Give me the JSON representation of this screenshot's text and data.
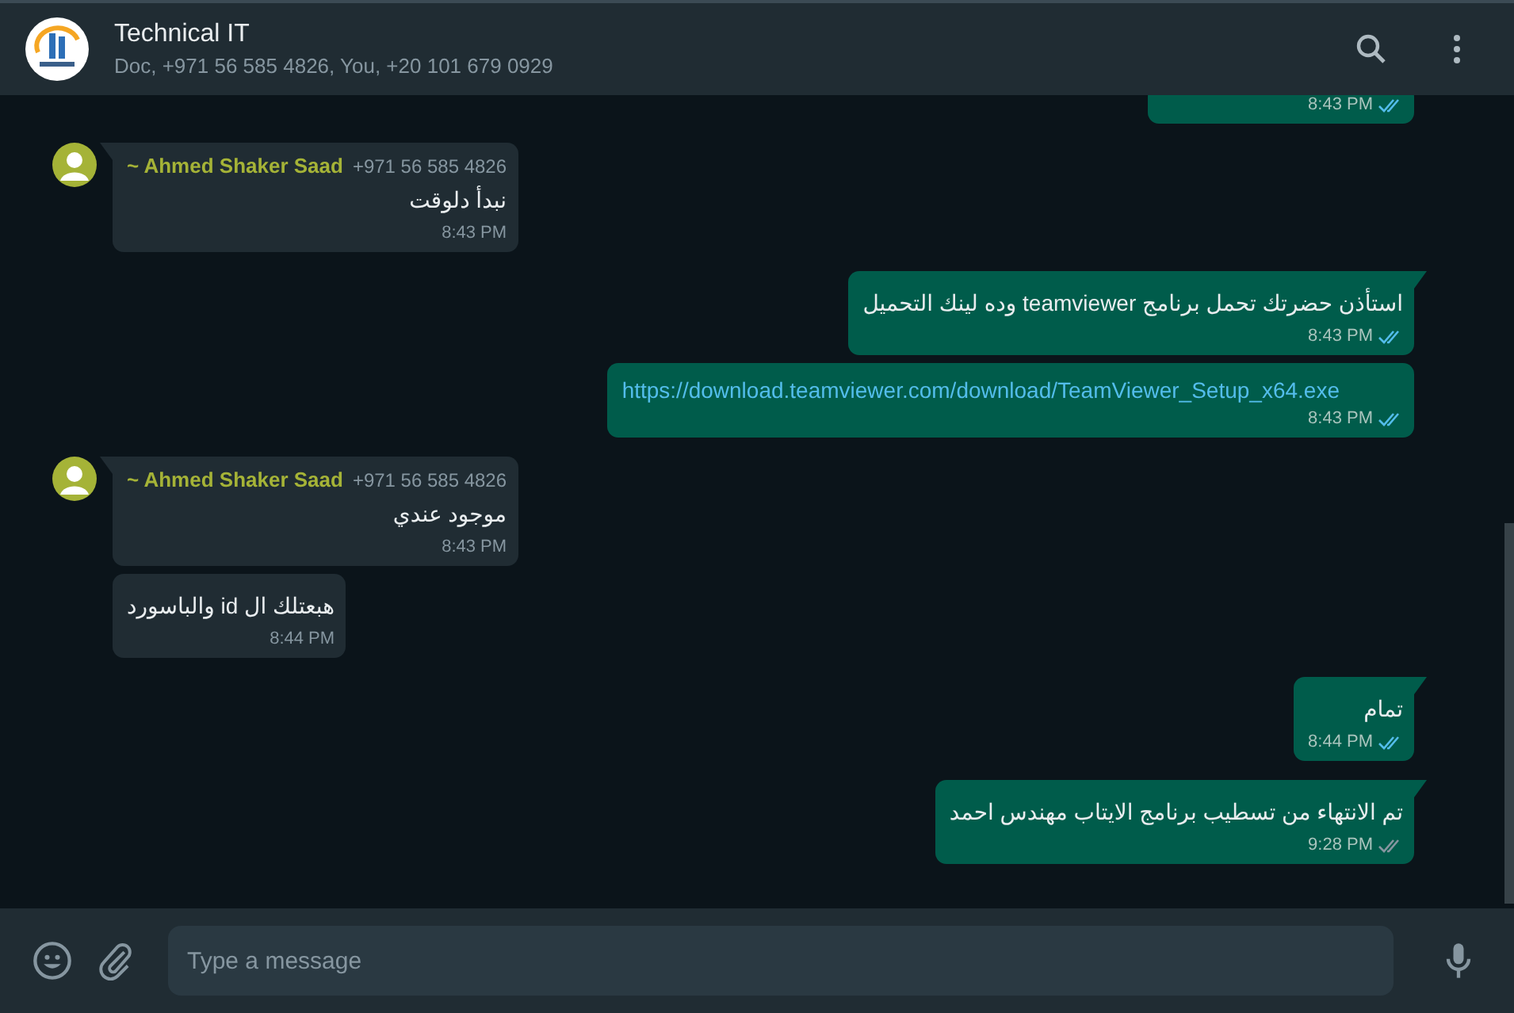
{
  "header": {
    "title": "Technical IT",
    "subtitle": "Doc, +971 56 585 4826, You, +20 101 679 0929"
  },
  "messages": [
    {
      "kind": "out",
      "tail": false,
      "time": "8:43 PM",
      "read": true
    },
    {
      "kind": "in",
      "tail": true,
      "sender": "~ Ahmed Shaker Saad",
      "phone": "+971 56 585 4826",
      "text": "نبدأ دلوقت",
      "time": "8:43 PM"
    },
    {
      "kind": "out",
      "tail": true,
      "text": "استأذن حضرتك تحمل برنامج teamviewer وده لينك التحميل",
      "time": "8:43 PM",
      "read": true
    },
    {
      "kind": "out",
      "tail": false,
      "link": "https://download.teamviewer.com/download/TeamViewer_Setup_x64.exe",
      "time": "8:43 PM",
      "read": true
    },
    {
      "kind": "in",
      "tail": true,
      "sender": "~ Ahmed Shaker Saad",
      "phone": "+971 56 585 4826",
      "text": "موجود عندي",
      "time": "8:43 PM"
    },
    {
      "kind": "in",
      "tail": false,
      "text": "هبعتلك ال id والباسورد",
      "time": "8:44 PM"
    },
    {
      "kind": "out",
      "tail": true,
      "text": "تمام",
      "time": "8:44 PM",
      "read": true
    },
    {
      "kind": "out",
      "tail": true,
      "text": "تم الانتهاء من تسطيب برنامج الايتاب مهندس احمد",
      "time": "9:28 PM",
      "read": false
    }
  ],
  "composer": {
    "placeholder": "Type a message"
  }
}
